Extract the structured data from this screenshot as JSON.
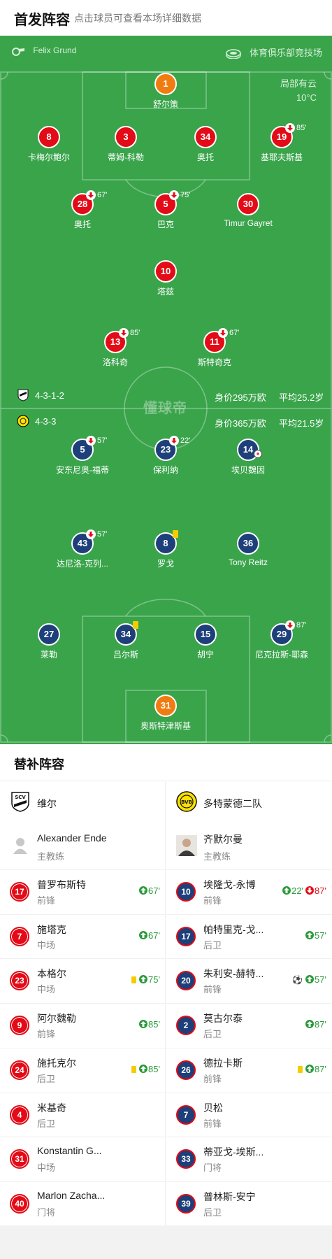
{
  "header": {
    "title": "首发阵容",
    "subtitle": "点击球员可查看本场详细数据"
  },
  "pitch": {
    "referee": "Felix Grund",
    "venue": "体育俱乐部竞技场",
    "weather": "局部有云",
    "temperature": "10°C",
    "watermark": "懂球帝",
    "home_info": {
      "formation": "4-3-1-2",
      "value": "身价295万欧",
      "age": "平均25.2岁"
    },
    "away_info": {
      "formation": "4-3-3",
      "value": "身价365万欧",
      "age": "平均21.5岁"
    }
  },
  "home_players": [
    {
      "num": "1",
      "name": "舒尔策",
      "gk": true
    },
    {
      "num": "8",
      "name": "卡梅尔鲍尔"
    },
    {
      "num": "3",
      "name": "蒂姆-科勒"
    },
    {
      "num": "34",
      "name": "奥托"
    },
    {
      "num": "19",
      "name": "基耶夫斯基",
      "sub_min": "85'"
    },
    {
      "num": "28",
      "name": "奥托",
      "sub_min": "67'"
    },
    {
      "num": "5",
      "name": "巴克",
      "sub_min": "75'"
    },
    {
      "num": "30",
      "name": "Timur Gayret"
    },
    {
      "num": "10",
      "name": "塔兹"
    },
    {
      "num": "13",
      "name": "洛科奇",
      "sub_min": "85'"
    },
    {
      "num": "11",
      "name": "斯特奇克",
      "sub_min": "67'"
    }
  ],
  "away_players": [
    {
      "num": "5",
      "name": "安东尼奥-福蒂",
      "sub_min": "57'"
    },
    {
      "num": "23",
      "name": "保利纳",
      "sub_min": "22'"
    },
    {
      "num": "14",
      "name": "埃贝魏因",
      "goal": true
    },
    {
      "num": "43",
      "name": "达尼洛-克列...",
      "sub_min": "57'"
    },
    {
      "num": "8",
      "name": "罗戈",
      "yellow": true
    },
    {
      "num": "36",
      "name": "Tony Reitz"
    },
    {
      "num": "27",
      "name": "莱勒"
    },
    {
      "num": "34",
      "name": "吕尔斯",
      "yellow": true
    },
    {
      "num": "15",
      "name": "胡宁"
    },
    {
      "num": "29",
      "name": "尼克拉斯-耶森",
      "sub_min": "87'"
    },
    {
      "num": "31",
      "name": "奥斯特津斯基",
      "gk": true
    }
  ],
  "subs": {
    "title": "替补阵容",
    "home": {
      "team": "维尔",
      "coach": {
        "name": "Alexander Ende",
        "role": "主教练"
      },
      "players": [
        {
          "num": "17",
          "name": "普罗布斯特",
          "pos": "前锋",
          "in": "67'"
        },
        {
          "num": "7",
          "name": "施塔克",
          "pos": "中场",
          "in": "67'"
        },
        {
          "num": "23",
          "name": "本格尔",
          "pos": "中场",
          "in": "75'",
          "yellow": true
        },
        {
          "num": "9",
          "name": "阿尔魏勒",
          "pos": "前锋",
          "in": "85'"
        },
        {
          "num": "24",
          "name": "施托克尔",
          "pos": "后卫",
          "in": "85'",
          "yellow": true
        },
        {
          "num": "4",
          "name": "米基奇",
          "pos": "后卫"
        },
        {
          "num": "31",
          "name": "Konstantin G...",
          "pos": "中场"
        },
        {
          "num": "40",
          "name": "Marlon Zacha...",
          "pos": "门将"
        }
      ]
    },
    "away": {
      "team": "多特蒙德二队",
      "coach": {
        "name": "齐默尔曼",
        "role": "主教练"
      },
      "players": [
        {
          "num": "10",
          "name": "埃隆戈-永博",
          "pos": "前锋",
          "in": "22'",
          "out": "87'"
        },
        {
          "num": "17",
          "name": "帕特里克-戈...",
          "pos": "后卫",
          "in": "57'"
        },
        {
          "num": "20",
          "name": "朱利安-赫特...",
          "pos": "前锋",
          "in": "57'",
          "goal": true
        },
        {
          "num": "2",
          "name": "莫古尔泰",
          "pos": "后卫",
          "in": "87'"
        },
        {
          "num": "26",
          "name": "德拉卡斯",
          "pos": "前锋",
          "in": "87'",
          "yellow": true
        },
        {
          "num": "7",
          "name": "贝松",
          "pos": "前锋"
        },
        {
          "num": "33",
          "name": "蒂亚戈-埃斯...",
          "pos": "门将"
        },
        {
          "num": "39",
          "name": "普林斯-安宁",
          "pos": "后卫"
        }
      ]
    }
  }
}
